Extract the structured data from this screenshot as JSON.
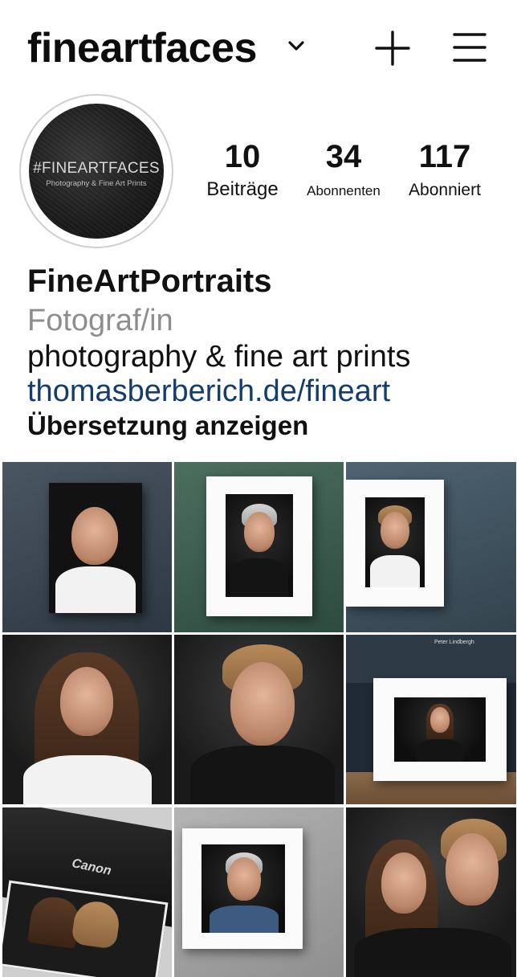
{
  "header": {
    "username": "fineartfaces",
    "icons": {
      "dropdown": "chevron-down-icon",
      "create": "plus-icon",
      "menu": "hamburger-menu-icon"
    }
  },
  "profile": {
    "avatar": {
      "title": "#FINEARTFACES",
      "subtitle": "Photography & Fine Art Prints"
    },
    "stats": {
      "posts": {
        "value": "10",
        "label": "Beiträge"
      },
      "followers": {
        "value": "34",
        "label": "Abonnenten"
      },
      "following": {
        "value": "117",
        "label": "Abonniert"
      }
    }
  },
  "bio": {
    "name": "FineArtPortraits",
    "category": "Fotograf/in",
    "text": "photography & fine art prints",
    "link": "thomasberberich.de/fineart",
    "translate": "Übersetzung anzeigen"
  },
  "grid": {
    "posts": [
      "canvas-portrait-bald-chef",
      "framed-portrait-grey-beard-man",
      "framed-portrait-blond-teen",
      "portrait-young-woman",
      "portrait-blond-teen-closeup",
      "gallery-framed-portrait-woman",
      "canon-printer-print",
      "framed-portrait-elderly-man",
      "portrait-couple"
    ],
    "printer_brand": "Canon",
    "gallery_sign": "Peter Lindbergh"
  },
  "colors": {
    "text": "#111111",
    "category": "#8e8e8e",
    "link": "#143d6e",
    "avatar_ring": "#cfcfcf"
  }
}
